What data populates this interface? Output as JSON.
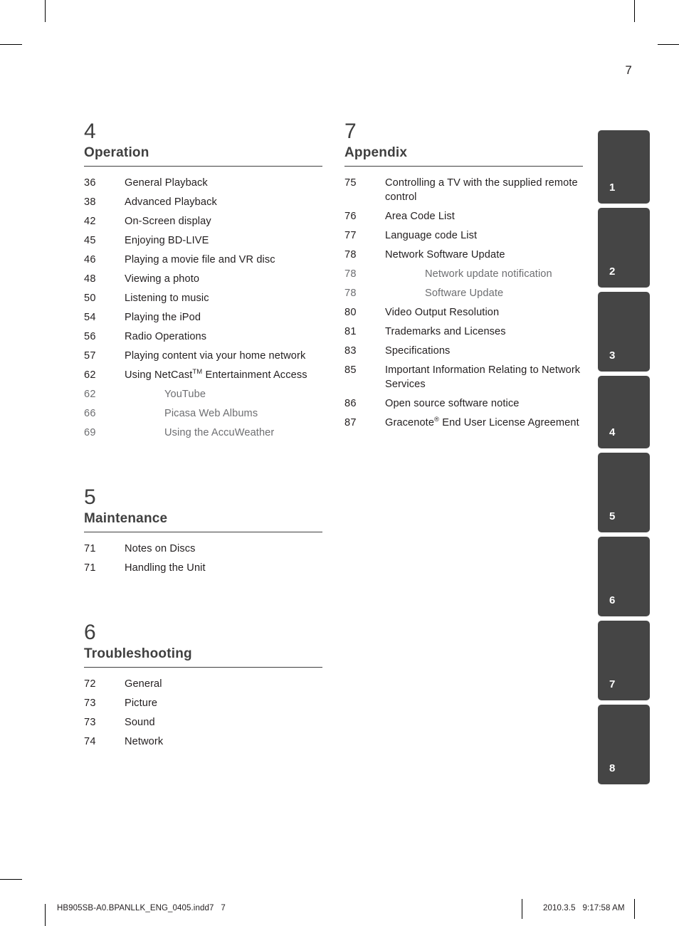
{
  "page": {
    "folio": "7",
    "tabs": [
      "1",
      "2",
      "3",
      "4",
      "5",
      "6",
      "7",
      "8"
    ],
    "footer": {
      "file": "HB905SB-A0.BPANLLK_ENG_0405.indd7   7",
      "timestamp": "2010.3.5   9:17:58 AM"
    },
    "colors": {
      "tab_background": "#454545",
      "tab_label": "#ffffff",
      "heading": "#3f3f3f",
      "body_text": "#231f20",
      "sub_text": "#6d6e71"
    }
  },
  "columns": [
    {
      "name": "left",
      "chapters": [
        {
          "number": "4",
          "title": "Operation",
          "entries": [
            {
              "page": "36",
              "title": "General Playback",
              "level": 1
            },
            {
              "page": "38",
              "title": "Advanced Playback",
              "level": 1
            },
            {
              "page": "42",
              "title": "On-Screen display",
              "level": 1
            },
            {
              "page": "45",
              "title": "Enjoying BD-LIVE",
              "level": 1
            },
            {
              "page": "46",
              "title": "Playing a movie file and VR disc",
              "level": 1
            },
            {
              "page": "48",
              "title": "Viewing a photo",
              "level": 1
            },
            {
              "page": "50",
              "title": "Listening to music",
              "level": 1
            },
            {
              "page": "54",
              "title": "Playing the iPod",
              "level": 1
            },
            {
              "page": "56",
              "title": "Radio Operations",
              "level": 1
            },
            {
              "page": "57",
              "title": "Playing content via your home network",
              "level": 1
            },
            {
              "page": "62",
              "title": "Using NetCast<sup>TM</sup> Entertainment Access",
              "level": 1,
              "html": true
            },
            {
              "page": "62",
              "title": "YouTube",
              "level": 2
            },
            {
              "page": "66",
              "title": "Picasa Web Albums",
              "level": 2
            },
            {
              "page": "69",
              "title": "Using the AccuWeather",
              "level": 2
            }
          ]
        },
        {
          "number": "5",
          "title": "Maintenance",
          "entries": [
            {
              "page": "71",
              "title": "Notes on Discs",
              "level": 1
            },
            {
              "page": "71",
              "title": "Handling the Unit",
              "level": 1
            }
          ]
        },
        {
          "number": "6",
          "title": "Troubleshooting",
          "entries": [
            {
              "page": "72",
              "title": "General",
              "level": 1
            },
            {
              "page": "73",
              "title": "Picture",
              "level": 1
            },
            {
              "page": "73",
              "title": "Sound",
              "level": 1
            },
            {
              "page": "74",
              "title": "Network",
              "level": 1
            }
          ]
        }
      ]
    },
    {
      "name": "right",
      "chapters": [
        {
          "number": "7",
          "title": "Appendix",
          "entries": [
            {
              "page": "75",
              "title": "Controlling a TV with the supplied remote control",
              "level": 1
            },
            {
              "page": "76",
              "title": "Area Code List",
              "level": 1
            },
            {
              "page": "77",
              "title": "Language code List",
              "level": 1
            },
            {
              "page": "78",
              "title": "Network Software Update",
              "level": 1
            },
            {
              "page": "78",
              "title": "Network update notification",
              "level": 2
            },
            {
              "page": "78",
              "title": "Software Update",
              "level": 2
            },
            {
              "page": "80",
              "title": "Video Output Resolution",
              "level": 1
            },
            {
              "page": "81",
              "title": "Trademarks and Licenses",
              "level": 1
            },
            {
              "page": "83",
              "title": "Specifications",
              "level": 1
            },
            {
              "page": "85",
              "title": "Important Information Relating to Network Services",
              "level": 1
            },
            {
              "page": "86",
              "title": "Open source software notice",
              "level": 1
            },
            {
              "page": "87",
              "title": "Gracenote<sup>&reg;</sup> End User License Agreement",
              "level": 1,
              "html": true
            }
          ]
        }
      ]
    }
  ]
}
